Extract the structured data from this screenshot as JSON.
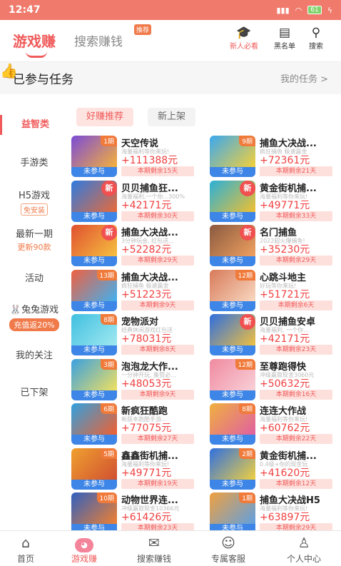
{
  "statusbar": {
    "time": "12:47",
    "battery": "61"
  },
  "header": {
    "tab_main": "游戏赚",
    "tab_search": "搜索赚钱",
    "tag_recommend": "推荐",
    "btn_newbie": "新人必看",
    "btn_blacklist": "黑名单",
    "btn_search": "搜索"
  },
  "tasks": {
    "title": "已参与任务",
    "my_tasks": "我的任务 >"
  },
  "sidebar": {
    "items": [
      {
        "label": "益智类"
      },
      {
        "label": "手游类"
      },
      {
        "label": "H5游戏",
        "sub": "免安装"
      },
      {
        "label": "最新一期",
        "sub": "更新90款"
      },
      {
        "label": "活动"
      },
      {
        "label": "兔兔游戏",
        "sub": "充值返20%"
      },
      {
        "label": "我的关注"
      },
      {
        "label": "已下架"
      }
    ]
  },
  "filters": [
    "好赚推荐",
    "新上架"
  ],
  "games": [
    {
      "name": "天空传说",
      "badge": "1期",
      "desc": "海量福利等你来玩!",
      "reward": "+111388元",
      "remain": "本期剩余15天",
      "status": "未参与"
    },
    {
      "name": "捕鱼大决战...",
      "badge": "9期",
      "desc": "疯狂捕鱼 极速赢金",
      "reward": "+72361元",
      "remain": "本期剩余21天",
      "status": "未参与"
    },
    {
      "name": "贝贝捕鱼狂...",
      "badge": "新",
      "desc": "海量福利,一个你...300%",
      "reward": "+42171元",
      "remain": "本期剩余30天",
      "status": "未参与"
    },
    {
      "name": "黄金街机捕...",
      "badge": "新",
      "desc": "海量福利等你来玩!",
      "reward": "+49771元",
      "remain": "本期剩余33天",
      "status": "未参与"
    },
    {
      "name": "捕鱼大决战...",
      "badge": "新",
      "desc": "3分钟玩会, 红包送...",
      "reward": "+52282元",
      "remain": "本期剩余29天",
      "status": "未参与"
    },
    {
      "name": "名门捕鱼",
      "badge": "新",
      "desc": "2022超火爆捕鱼!",
      "reward": "+35230元",
      "remain": "本期剩余29天",
      "status": "未参与"
    },
    {
      "name": "捕鱼大决战...",
      "badge": "13期",
      "desc": "疯狂捕鱼 极速赢金",
      "reward": "+51223元",
      "remain": "本期剩余9天",
      "status": "未参与"
    },
    {
      "name": "心跳斗地主",
      "badge": "12期",
      "desc": "好玩等你来玩!",
      "reward": "+51721元",
      "remain": "本期剩余6天",
      "status": "未参与"
    },
    {
      "name": "宠物派对",
      "badge": "8期",
      "desc": "经典休闲游戏红包送",
      "reward": "+78031元",
      "remain": "本期剩余8天",
      "status": "未参与"
    },
    {
      "name": "贝贝捕鱼安卓",
      "badge": "新",
      "desc": "海量福利, 一个你...",
      "reward": "+42171元",
      "remain": "本期剩余23天",
      "status": "未参与"
    },
    {
      "name": "泡泡龙大作...",
      "badge": "3期",
      "desc": "一分钟开玩, 集赞必...",
      "reward": "+48053元",
      "remain": "本期剩余9天",
      "status": "未参与"
    },
    {
      "name": "至尊跑得快",
      "badge": "12期",
      "desc": "冲级赢取现金3060元",
      "reward": "+50632元",
      "remain": "本期剩余16天",
      "status": "未参与"
    },
    {
      "name": "新疯狂酷跑",
      "badge": "6期",
      "desc": "新版本跑酷手游...",
      "reward": "+77075元",
      "remain": "本期剩余27天",
      "status": "未参与"
    },
    {
      "name": "连连大作战",
      "badge": "8期",
      "desc": "海量福利等你来玩!",
      "reward": "+60762元",
      "remain": "本期剩余22天",
      "status": "未参与"
    },
    {
      "name": "鑫鑫街机捕...",
      "badge": "5期",
      "desc": "海量福利等你来玩!",
      "reward": "+49771元",
      "remain": "本期剩余19天",
      "status": "未参与"
    },
    {
      "name": "黄金街机捕...",
      "badge": "2期",
      "desc": "0.4级+你的现金玩",
      "reward": "+41620元",
      "remain": "本期剩余12天",
      "status": "未参与"
    },
    {
      "name": "动物世界连...",
      "badge": "10期",
      "desc": "冲级赢取现金10366元",
      "reward": "+61426元",
      "remain": "本期剩余23天",
      "status": "未参与"
    },
    {
      "name": "捕鱼大决战H5",
      "badge": "1期",
      "desc": "海量福利等你来玩!",
      "reward": "+63897元",
      "remain": "本期剩余29天",
      "status": "未参与"
    }
  ],
  "tabbar": [
    "首页",
    "游戏赚",
    "搜索赚钱",
    "专属客服",
    "个人中心"
  ]
}
